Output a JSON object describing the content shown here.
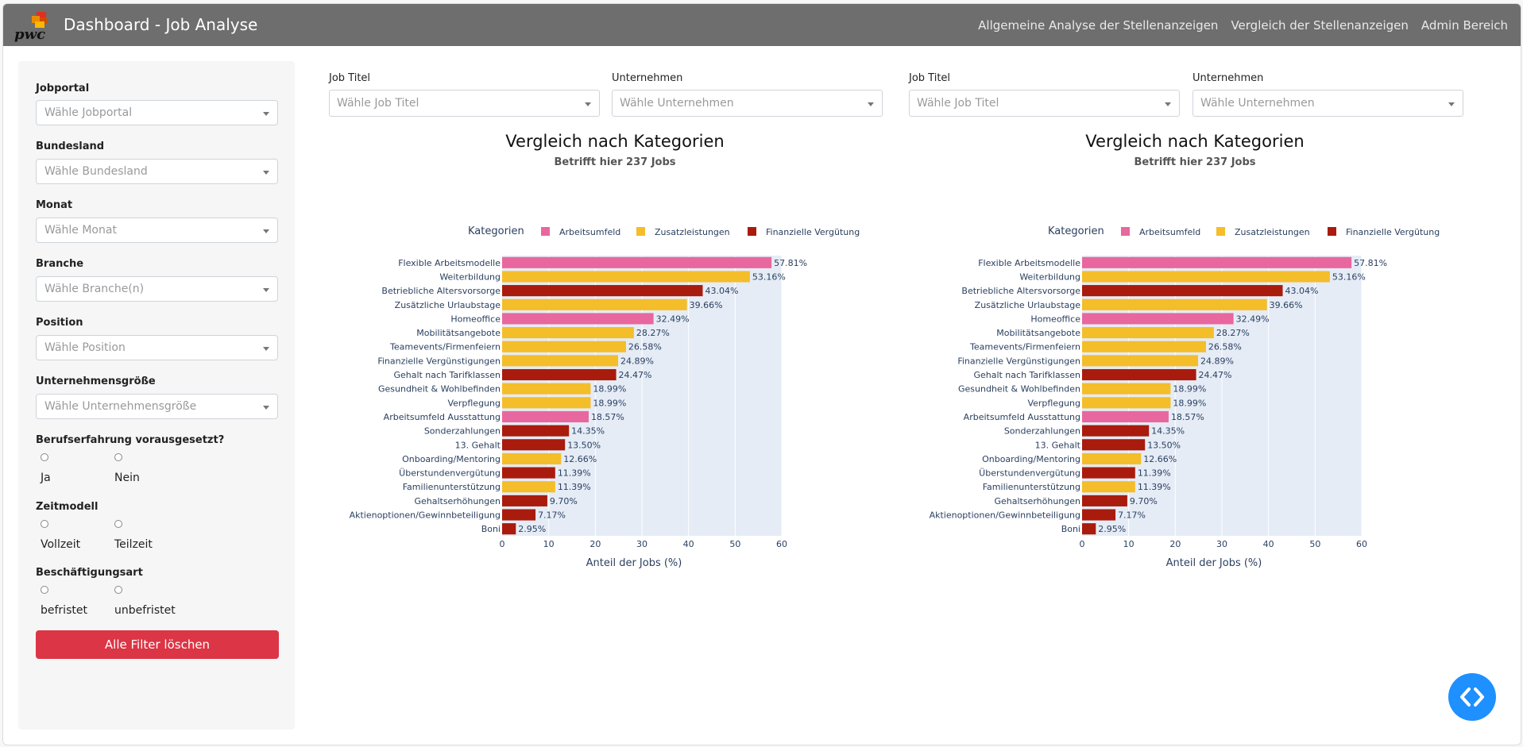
{
  "app": {
    "title": "Dashboard - Job Analyse",
    "logo_text": "pwc",
    "nav": [
      "Allgemeine Analyse der Stellenanzeigen",
      "Vergleich der Stellenanzeigen",
      "Admin Bereich"
    ]
  },
  "sidebar": {
    "filters": [
      {
        "label": "Jobportal",
        "placeholder": "Wähle Jobportal"
      },
      {
        "label": "Bundesland",
        "placeholder": "Wähle Bundesland"
      },
      {
        "label": "Monat",
        "placeholder": "Wähle Monat"
      },
      {
        "label": "Branche",
        "placeholder": "Wähle Branche(n)"
      },
      {
        "label": "Position",
        "placeholder": "Wähle Position"
      },
      {
        "label": "Unternehmensgröße",
        "placeholder": "Wähle Unternehmensgröße"
      }
    ],
    "radio_groups": [
      {
        "label": "Berufserfahrung vorausgesetzt?",
        "options": [
          "Ja",
          "Nein"
        ]
      },
      {
        "label": "Zeitmodell",
        "options": [
          "Vollzeit",
          "Teilzeit"
        ]
      },
      {
        "label": "Beschäftigungsart",
        "options": [
          "befristet",
          "unbefristet"
        ]
      }
    ],
    "clear_button": "Alle Filter löschen"
  },
  "compare": {
    "job_title_label": "Job Titel",
    "job_title_placeholder": "Wähle Job Titel",
    "company_label": "Unternehmen",
    "company_placeholder": "Wähle Unternehmen"
  },
  "colors": {
    "Arbeitsumfeld": "#e8679e",
    "Zusatzleistungen": "#f4bd2a",
    "Finanzielle Vergütung": "#a91b0d",
    "plot_bg": "#e5ecf6",
    "navbar": "#6e6e6e",
    "danger": "#dc3545",
    "fab": "#1e90ff"
  },
  "chart_data": [
    {
      "type": "bar",
      "orientation": "horizontal",
      "title": "Vergleich nach Kategorien",
      "subtitle": "Betrifft hier 237 Jobs",
      "xlabel": "Anteil der Jobs (%)",
      "ylabel": "",
      "xlim": [
        0,
        60
      ],
      "xticks": [
        0,
        10,
        20,
        30,
        40,
        50,
        60
      ],
      "legend_title": "Kategorien",
      "legend": [
        "Arbeitsumfeld",
        "Zusatzleistungen",
        "Finanzielle Vergütung"
      ],
      "legend_position": "top",
      "grid": true,
      "bars": [
        {
          "label": "Flexible Arbeitsmodelle",
          "value": 57.81,
          "text": "57.81%",
          "category": "Arbeitsumfeld"
        },
        {
          "label": "Weiterbildung",
          "value": 53.16,
          "text": "53.16%",
          "category": "Zusatzleistungen"
        },
        {
          "label": "Betriebliche Altersvorsorge",
          "value": 43.04,
          "text": "43.04%",
          "category": "Finanzielle Vergütung"
        },
        {
          "label": "Zusätzliche Urlaubstage",
          "value": 39.66,
          "text": "39.66%",
          "category": "Zusatzleistungen"
        },
        {
          "label": "Homeoffice",
          "value": 32.49,
          "text": "32.49%",
          "category": "Arbeitsumfeld"
        },
        {
          "label": "Mobilitätsangebote",
          "value": 28.27,
          "text": "28.27%",
          "category": "Zusatzleistungen"
        },
        {
          "label": "Teamevents/Firmenfeiern",
          "value": 26.58,
          "text": "26.58%",
          "category": "Zusatzleistungen"
        },
        {
          "label": "Finanzielle Vergünstigungen",
          "value": 24.89,
          "text": "24.89%",
          "category": "Zusatzleistungen"
        },
        {
          "label": "Gehalt nach Tarifklassen",
          "value": 24.47,
          "text": "24.47%",
          "category": "Finanzielle Vergütung"
        },
        {
          "label": "Gesundheit & Wohlbefinden",
          "value": 18.99,
          "text": "18.99%",
          "category": "Zusatzleistungen"
        },
        {
          "label": "Verpflegung",
          "value": 18.99,
          "text": "18.99%",
          "category": "Zusatzleistungen"
        },
        {
          "label": "Arbeitsumfeld Ausstattung",
          "value": 18.57,
          "text": "18.57%",
          "category": "Arbeitsumfeld"
        },
        {
          "label": "Sonderzahlungen",
          "value": 14.35,
          "text": "14.35%",
          "category": "Finanzielle Vergütung"
        },
        {
          "label": "13. Gehalt",
          "value": 13.5,
          "text": "13.50%",
          "category": "Finanzielle Vergütung"
        },
        {
          "label": "Onboarding/Mentoring",
          "value": 12.66,
          "text": "12.66%",
          "category": "Zusatzleistungen"
        },
        {
          "label": "Überstundenvergütung",
          "value": 11.39,
          "text": "11.39%",
          "category": "Finanzielle Vergütung"
        },
        {
          "label": "Familienunterstützung",
          "value": 11.39,
          "text": "11.39%",
          "category": "Zusatzleistungen"
        },
        {
          "label": "Gehaltserhöhungen",
          "value": 9.7,
          "text": "9.70%",
          "category": "Finanzielle Vergütung"
        },
        {
          "label": "Aktienoptionen/Gewinnbeteiligung",
          "value": 7.17,
          "text": "7.17%",
          "category": "Finanzielle Vergütung"
        },
        {
          "label": "Boni",
          "value": 2.95,
          "text": "2.95%",
          "category": "Finanzielle Vergütung"
        }
      ]
    },
    {
      "type": "bar",
      "orientation": "horizontal",
      "title": "Vergleich nach Kategorien",
      "subtitle": "Betrifft hier 237 Jobs",
      "xlabel": "Anteil der Jobs (%)",
      "ylabel": "",
      "xlim": [
        0,
        60
      ],
      "xticks": [
        0,
        10,
        20,
        30,
        40,
        50,
        60
      ],
      "legend_title": "Kategorien",
      "legend": [
        "Arbeitsumfeld",
        "Zusatzleistungen",
        "Finanzielle Vergütung"
      ],
      "legend_position": "top",
      "grid": true,
      "bars": [
        {
          "label": "Flexible Arbeitsmodelle",
          "value": 57.81,
          "text": "57.81%",
          "category": "Arbeitsumfeld"
        },
        {
          "label": "Weiterbildung",
          "value": 53.16,
          "text": "53.16%",
          "category": "Zusatzleistungen"
        },
        {
          "label": "Betriebliche Altersvorsorge",
          "value": 43.04,
          "text": "43.04%",
          "category": "Finanzielle Vergütung"
        },
        {
          "label": "Zusätzliche Urlaubstage",
          "value": 39.66,
          "text": "39.66%",
          "category": "Zusatzleistungen"
        },
        {
          "label": "Homeoffice",
          "value": 32.49,
          "text": "32.49%",
          "category": "Arbeitsumfeld"
        },
        {
          "label": "Mobilitätsangebote",
          "value": 28.27,
          "text": "28.27%",
          "category": "Zusatzleistungen"
        },
        {
          "label": "Teamevents/Firmenfeiern",
          "value": 26.58,
          "text": "26.58%",
          "category": "Zusatzleistungen"
        },
        {
          "label": "Finanzielle Vergünstigungen",
          "value": 24.89,
          "text": "24.89%",
          "category": "Zusatzleistungen"
        },
        {
          "label": "Gehalt nach Tarifklassen",
          "value": 24.47,
          "text": "24.47%",
          "category": "Finanzielle Vergütung"
        },
        {
          "label": "Gesundheit & Wohlbefinden",
          "value": 18.99,
          "text": "18.99%",
          "category": "Zusatzleistungen"
        },
        {
          "label": "Verpflegung",
          "value": 18.99,
          "text": "18.99%",
          "category": "Zusatzleistungen"
        },
        {
          "label": "Arbeitsumfeld Ausstattung",
          "value": 18.57,
          "text": "18.57%",
          "category": "Arbeitsumfeld"
        },
        {
          "label": "Sonderzahlungen",
          "value": 14.35,
          "text": "14.35%",
          "category": "Finanzielle Vergütung"
        },
        {
          "label": "13. Gehalt",
          "value": 13.5,
          "text": "13.50%",
          "category": "Finanzielle Vergütung"
        },
        {
          "label": "Onboarding/Mentoring",
          "value": 12.66,
          "text": "12.66%",
          "category": "Zusatzleistungen"
        },
        {
          "label": "Überstundenvergütung",
          "value": 11.39,
          "text": "11.39%",
          "category": "Finanzielle Vergütung"
        },
        {
          "label": "Familienunterstützung",
          "value": 11.39,
          "text": "11.39%",
          "category": "Zusatzleistungen"
        },
        {
          "label": "Gehaltserhöhungen",
          "value": 9.7,
          "text": "9.70%",
          "category": "Finanzielle Vergütung"
        },
        {
          "label": "Aktienoptionen/Gewinnbeteiligung",
          "value": 7.17,
          "text": "7.17%",
          "category": "Finanzielle Vergütung"
        },
        {
          "label": "Boni",
          "value": 2.95,
          "text": "2.95%",
          "category": "Finanzielle Vergütung"
        }
      ]
    }
  ]
}
